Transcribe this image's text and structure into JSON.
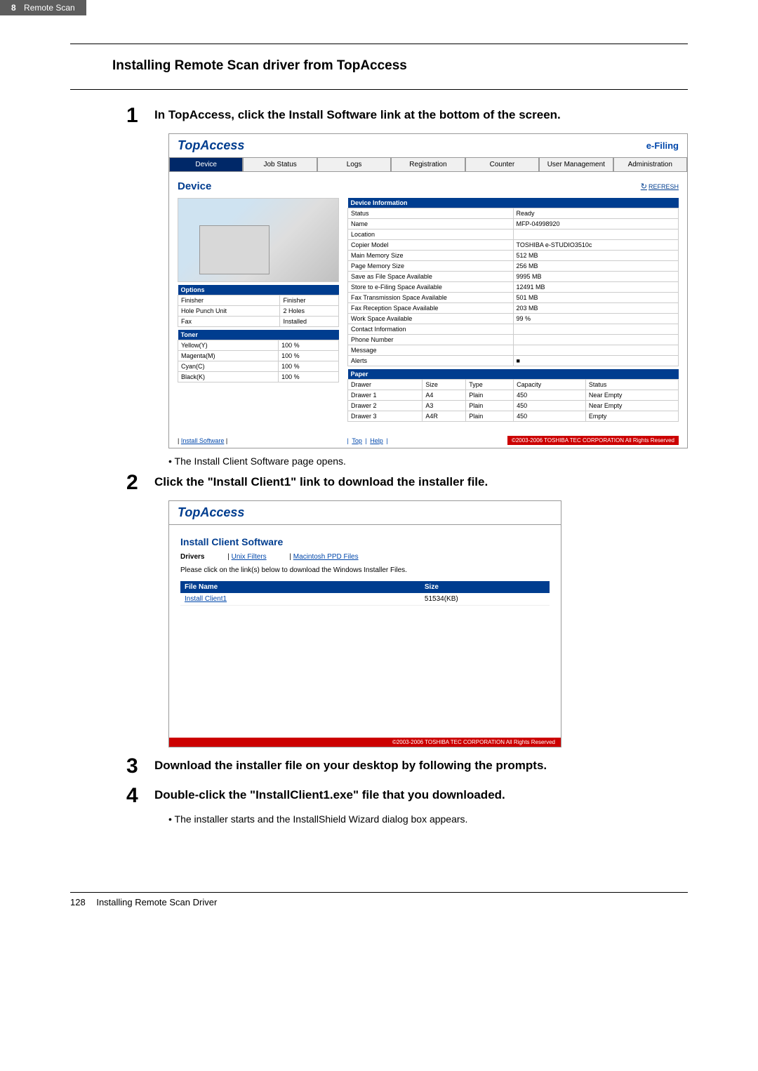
{
  "header": {
    "page_num": "8",
    "chapter": "Remote Scan"
  },
  "section_title": "Installing Remote Scan driver from TopAccess",
  "steps": [
    {
      "num": "1",
      "text": "In TopAccess, click the Install Software link at the bottom of the screen."
    },
    {
      "num": "2",
      "text": "Click the \"Install Client1\" link to download the installer file."
    },
    {
      "num": "3",
      "text": "Download the installer file on your desktop by following the prompts."
    },
    {
      "num": "4",
      "text": "Double-click the \"InstallClient1.exe\" file that you downloaded."
    }
  ],
  "bullets": {
    "after1": "The Install Client Software page opens.",
    "after4": "The installer starts and the InstallShield Wizard dialog box appears."
  },
  "ta": {
    "logo": "TopAccess",
    "efiling": "e-Filing",
    "tabs": [
      "Device",
      "Job Status",
      "Logs",
      "Registration",
      "Counter",
      "User Management",
      "Administration"
    ],
    "refresh": "REFRESH",
    "device_title": "Device",
    "options_hdr": "Options",
    "options": [
      {
        "k": "Finisher",
        "v": "Finisher"
      },
      {
        "k": "Hole Punch Unit",
        "v": "2 Holes"
      },
      {
        "k": "Fax",
        "v": "Installed"
      }
    ],
    "toner_hdr": "Toner",
    "toner": [
      {
        "k": "Yellow(Y)",
        "v": "100 %"
      },
      {
        "k": "Magenta(M)",
        "v": "100 %"
      },
      {
        "k": "Cyan(C)",
        "v": "100 %"
      },
      {
        "k": "Black(K)",
        "v": "100 %"
      }
    ],
    "devinfo_hdr": "Device Information",
    "devinfo": [
      {
        "k": "Status",
        "v": "Ready"
      },
      {
        "k": "Name",
        "v": "MFP-04998920"
      },
      {
        "k": "Location",
        "v": ""
      },
      {
        "k": "Copier Model",
        "v": "TOSHIBA e-STUDIO3510c"
      },
      {
        "k": "Main Memory Size",
        "v": "512 MB"
      },
      {
        "k": "Page Memory Size",
        "v": "256 MB"
      },
      {
        "k": "Save as File Space Available",
        "v": "9995 MB"
      },
      {
        "k": "Store to e-Filing Space Available",
        "v": "12491 MB"
      },
      {
        "k": "Fax Transmission Space Available",
        "v": "501 MB"
      },
      {
        "k": "Fax Reception Space Available",
        "v": "203 MB"
      },
      {
        "k": "Work Space Available",
        "v": "99 %"
      },
      {
        "k": "Contact Information",
        "v": ""
      },
      {
        "k": "Phone Number",
        "v": ""
      },
      {
        "k": "Message",
        "v": ""
      },
      {
        "k": "Alerts",
        "v": "■"
      }
    ],
    "paper_hdr": "Paper",
    "paper_cols": [
      "Drawer",
      "Size",
      "Type",
      "Capacity",
      "Status"
    ],
    "paper": [
      [
        "Drawer 1",
        "A4",
        "Plain",
        "450",
        "Near Empty"
      ],
      [
        "Drawer 2",
        "A3",
        "Plain",
        "450",
        "Near Empty"
      ],
      [
        "Drawer 3",
        "A4R",
        "Plain",
        "450",
        "Empty"
      ]
    ],
    "footer_left": "Install Software",
    "footer_center_top": "Top",
    "footer_center_help": "Help",
    "footer_right": "©2003-2006 TOSHIBA TEC CORPORATION All Rights Reserved"
  },
  "s2": {
    "title": "Install Client Software",
    "tab_drivers": "Drivers",
    "tab_unix": "Unix Filters",
    "tab_mac": "Macintosh PPD Files",
    "instruction": "Please click on the link(s) below to download the Windows Installer Files.",
    "col_file": "File Name",
    "col_size": "Size",
    "link_name": "Install Client1",
    "link_size": "51534(KB)",
    "footer": "©2003-2006 TOSHIBA TEC CORPORATION All Rights Reserved"
  },
  "footer": {
    "page_num": "128",
    "title": "Installing Remote Scan Driver"
  }
}
